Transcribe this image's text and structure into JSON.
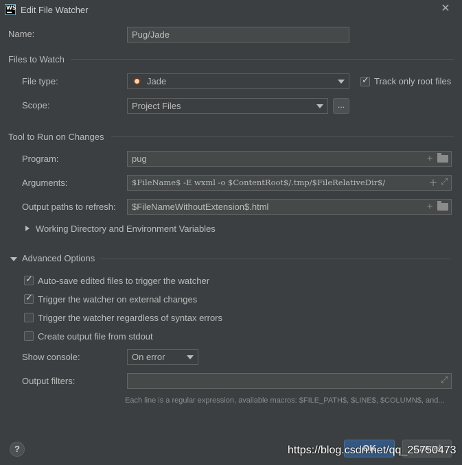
{
  "window": {
    "title": "Edit File Watcher",
    "logo_text": "WS"
  },
  "name": {
    "label": "Name:",
    "value": "Pug/Jade"
  },
  "files_to_watch": {
    "header": "Files to Watch",
    "file_type_label": "File type:",
    "file_type_value": "Jade",
    "track_root_label": "Track only root files",
    "track_root_checked": true,
    "scope_label": "Scope:",
    "scope_value": "Project Files",
    "scope_button": "..."
  },
  "tool": {
    "header": "Tool to Run on Changes",
    "program_label": "Program:",
    "program_value": "pug",
    "arguments_label": "Arguments:",
    "arguments_value": "$FileName$ -E wxml -o $ContentRoot$/.tmp/$FileRelativeDir$/",
    "output_label": "Output paths to refresh:",
    "output_value": "$FileNameWithoutExtension$.html",
    "workdir_label": "Working Directory and Environment Variables"
  },
  "advanced": {
    "header": "Advanced Options",
    "options": [
      {
        "label": "Auto-save edited files to trigger the watcher",
        "checked": true
      },
      {
        "label": "Trigger the watcher on external changes",
        "checked": true
      },
      {
        "label": "Trigger the watcher regardless of syntax errors",
        "checked": false
      },
      {
        "label": "Create output file from stdout",
        "checked": false
      }
    ],
    "console_label": "Show console:",
    "console_value": "On error",
    "filters_label": "Output filters:",
    "filters_value": "",
    "hint": "Each line is a regular expression, available macros: $FILE_PATH$, $LINE$, $COLUMN$, and..."
  },
  "footer": {
    "help": "?",
    "ok": "OK",
    "cancel": "Cancel"
  },
  "watermark": "https://blog.csdn.net/qq_25750473"
}
